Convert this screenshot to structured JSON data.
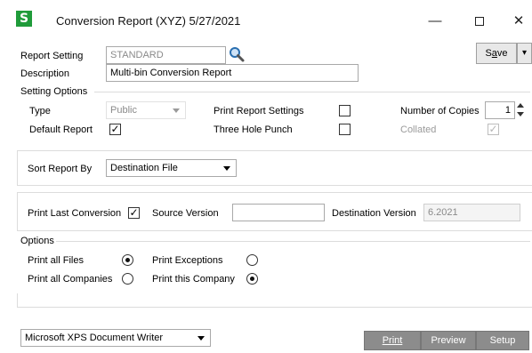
{
  "window": {
    "app_icon_letter": "S",
    "title": "Conversion Report (XYZ) 5/27/2021",
    "minimize": "—",
    "close": "✕"
  },
  "report_setting": {
    "label": "Report Setting",
    "value": "STANDARD",
    "lookup_icon": "magnifier-icon"
  },
  "description": {
    "label": "Description",
    "value": "Multi-bin Conversion Report"
  },
  "save_button": {
    "label_prefix": "S",
    "label_hot": "a",
    "label_suffix": "ve",
    "menu_arrow": "▾"
  },
  "setting_options": {
    "header": "Setting Options",
    "type_label": "Type",
    "type_value": "Public",
    "default_report_label": "Default Report",
    "default_report_checked": true,
    "print_report_settings_label": "Print Report Settings",
    "print_report_settings_checked": false,
    "three_hole_punch_label": "Three Hole Punch",
    "three_hole_punch_checked": false,
    "number_of_copies_label": "Number of Copies",
    "number_of_copies_value": "1",
    "collated_label": "Collated",
    "collated_checked": true
  },
  "sort": {
    "label": "Sort Report By",
    "value": "Destination File"
  },
  "version": {
    "print_last_conversion_label": "Print Last Conversion",
    "print_last_conversion_checked": true,
    "source_version_label": "Source Version",
    "source_version_value": "",
    "destination_version_label": "Destination Version",
    "destination_version_value": "6.2021"
  },
  "options": {
    "header": "Options",
    "print_all_files_label": "Print all Files",
    "print_all_files_selected": true,
    "print_all_companies_label": "Print all Companies",
    "print_all_companies_selected": false,
    "print_exceptions_label": "Print Exceptions",
    "print_exceptions_selected": false,
    "print_this_company_label": "Print this Company",
    "print_this_company_selected": true
  },
  "printer": {
    "value": "Microsoft XPS Document Writer"
  },
  "buttons": {
    "print": "Print",
    "preview": "Preview",
    "setup": "Setup"
  },
  "colors": {
    "app_icon": "#1f9b3a",
    "dark_button": "#8c8c8c"
  }
}
